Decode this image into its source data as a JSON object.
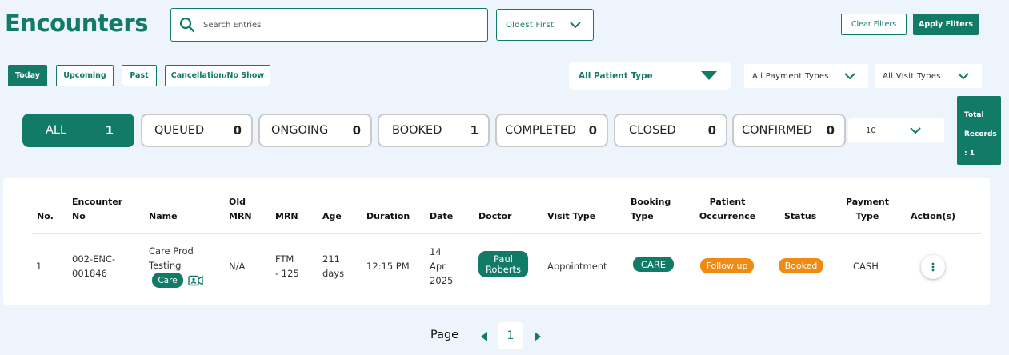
{
  "header": {
    "title": "Encounters",
    "search_placeholder": "Search Entries",
    "sort_label": "Oldest First",
    "clear_filters": "Clear Filters",
    "apply_filters": "Apply Filters"
  },
  "tabs": [
    "Today",
    "Upcoming",
    "Past",
    "Cancellation/No Show"
  ],
  "filters": {
    "patient_type": "All Patient Type",
    "payment_type": "All Payment Types",
    "visit_type": "All Visit Types"
  },
  "status_counts": [
    {
      "label": "ALL",
      "count": "1"
    },
    {
      "label": "QUEUED",
      "count": "0"
    },
    {
      "label": "ONGOING",
      "count": "0"
    },
    {
      "label": "BOOKED",
      "count": "1"
    },
    {
      "label": "COMPLETED",
      "count": "0"
    },
    {
      "label": "CLOSED",
      "count": "0"
    },
    {
      "label": "CONFIRMED",
      "count": "0"
    }
  ],
  "per_page": "10",
  "total_records": {
    "line1": "Total",
    "line2": "Records",
    "line3": ": 1"
  },
  "table": {
    "headers": {
      "no": "No.",
      "encounter_no_1": "Encounter",
      "encounter_no_2": "No",
      "name": "Name",
      "old_mrn_1": "Old",
      "old_mrn_2": "MRN",
      "mrn": "MRN",
      "age": "Age",
      "duration": "Duration",
      "date": "Date",
      "doctor": "Doctor",
      "visit_type": "Visit Type",
      "booking_type_1": "Booking",
      "booking_type_2": "Type",
      "occurrence_1": "Patient",
      "occurrence_2": "Occurrence",
      "status": "Status",
      "payment_type_1": "Payment",
      "payment_type_2": "Type",
      "actions": "Action(s)"
    },
    "rows": [
      {
        "no": "1",
        "encounter_no_1": "002-ENC-",
        "encounter_no_2": "001846",
        "name_1": "Care Prod",
        "name_2": "Testing",
        "patient_tag": "Care",
        "old_mrn": "N/A",
        "mrn_1": "FTM",
        "mrn_2": "- 125",
        "age_1": "211",
        "age_2": "days",
        "duration": "12:15 PM",
        "date_1": "14",
        "date_2": "Apr",
        "date_3": "2025",
        "doctor_1": "Paul",
        "doctor_2": "Roberts",
        "visit_type": "Appointment",
        "booking_type": "CARE",
        "occurrence": "Follow up",
        "status": "Booked",
        "payment_type": "CASH"
      }
    ]
  },
  "pagination": {
    "label": "Page",
    "current": "1"
  },
  "colors": {
    "primary": "#127b68",
    "orange": "#f08a12",
    "background": "#eef4fb"
  }
}
